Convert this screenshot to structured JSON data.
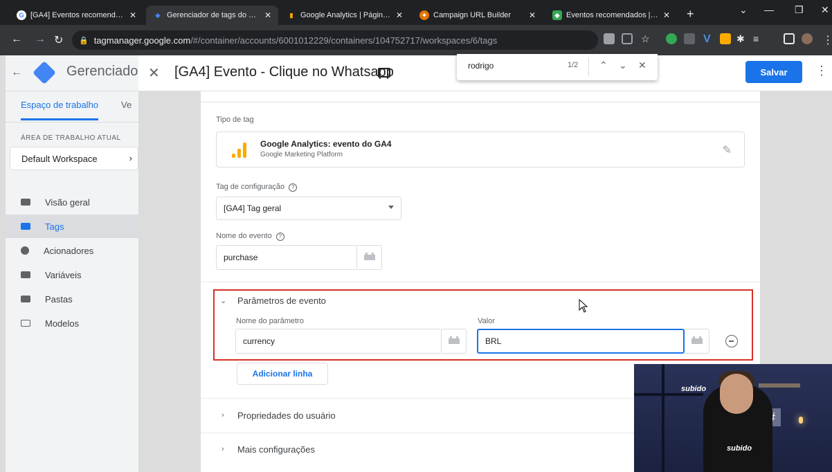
{
  "browser": {
    "tabs": [
      {
        "title": "[GA4] Eventos recomendado",
        "fav_color": "#4285f4",
        "fav_text": "G"
      },
      {
        "title": "Gerenciador de tags do Goo",
        "fav_color": "#4285f4",
        "fav_text": "◆"
      },
      {
        "title": "Google Analytics | Página inic",
        "fav_color": "#f9ab00",
        "fav_text": "▮"
      },
      {
        "title": "Campaign URL Builder",
        "fav_color": "#e37400",
        "fav_text": "✦"
      },
      {
        "title": "Eventos recomendados | Pr",
        "fav_color": "#34a853",
        "fav_text": "◆"
      }
    ],
    "url_host": "tagmanager.google.com",
    "url_path": "/#/container/accounts/6001012229/containers/104752717/workspaces/6/tags"
  },
  "find_bar": {
    "query": "rodrigo",
    "count": "1/2"
  },
  "gtm": {
    "app_title": "Gerenciado",
    "workspace_tab": "Espaço de trabalho",
    "versions_tab": "Ve",
    "current_ws_label": "ÁREA DE TRABALHO ATUAL",
    "current_ws": "Default Workspace",
    "nav": [
      {
        "label": "Visão geral"
      },
      {
        "label": "Tags"
      },
      {
        "label": "Acionadores"
      },
      {
        "label": "Variáveis"
      },
      {
        "label": "Pastas"
      },
      {
        "label": "Modelos"
      }
    ]
  },
  "editor": {
    "title": "[GA4] Evento - Clique no Whatsapp",
    "save": "Salvar",
    "tag_type_label": "Tipo de tag",
    "tag_type_name": "Google Analytics: evento do GA4",
    "tag_type_platform": "Google Marketing Platform",
    "config_tag_label": "Tag de configuração",
    "config_tag_value": "[GA4] Tag geral",
    "event_name_label": "Nome do evento",
    "event_name_value": "purchase",
    "params_section": "Parâmetros de evento",
    "param_name_label": "Nome do parâmetro",
    "param_value_label": "Valor",
    "param_name": "currency",
    "param_value": "BRL",
    "add_row": "Adicionar linha",
    "user_props": "Propriedades do usuário",
    "more_settings": "Mais configurações"
  },
  "webcam": {
    "brand_top": "subido",
    "brand_shirt": "subido"
  },
  "colors": {
    "accent": "#1a73e8",
    "highlight": "#d93025"
  }
}
